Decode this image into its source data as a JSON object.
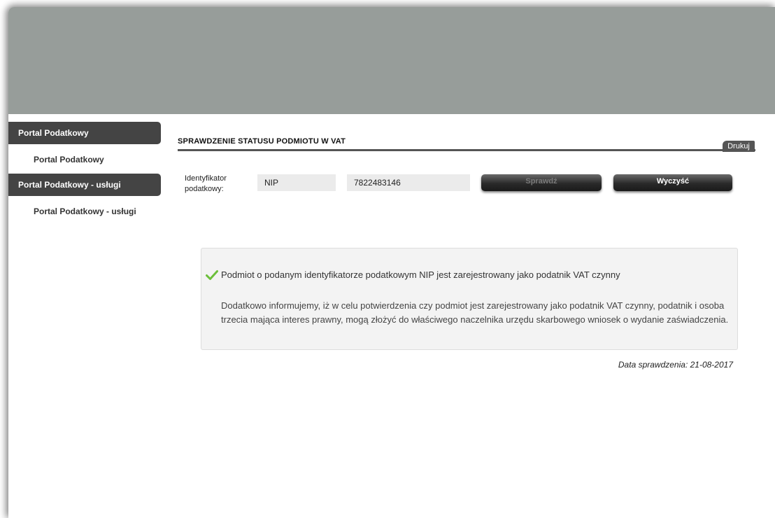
{
  "sidebar": {
    "sections": [
      {
        "header": "Portal Podatkowy",
        "link": "Portal Podatkowy"
      },
      {
        "header": "Portal Podatkowy - usługi",
        "link": "Portal Podatkowy - usługi"
      }
    ]
  },
  "main": {
    "title": "SPRAWDZENIE STATUSU PODMIOTU W VAT",
    "print_label": "Drukuj",
    "form": {
      "label_line1": "Identyfikator",
      "label_line2": "podatkowy:",
      "id_type": "NIP",
      "id_value": "7822483146",
      "check_label": "Sprawdź",
      "clear_label": "Wyczyść"
    },
    "result": {
      "status_icon": "check-icon",
      "message": "Podmiot o podanym identyfikatorze podatkowym NIP jest zarejestrowany jako podatnik VAT czynny",
      "info": "Dodatkowo informujemy, iż w celu potwierdzenia czy podmiot jest zarejestrowany jako podatnik VAT czynny, podatnik i osoba trzecia mająca interes prawny, mogą złożyć do właściwego naczelnika urzędu skarbowego wniosek o wydanie zaświadczenia."
    },
    "check_date": "Data sprawdzenia: 21-08-2017"
  },
  "colors": {
    "banner": "#979d9a",
    "sidebar_header": "#444444",
    "accent_check": "#6cbf3a"
  }
}
